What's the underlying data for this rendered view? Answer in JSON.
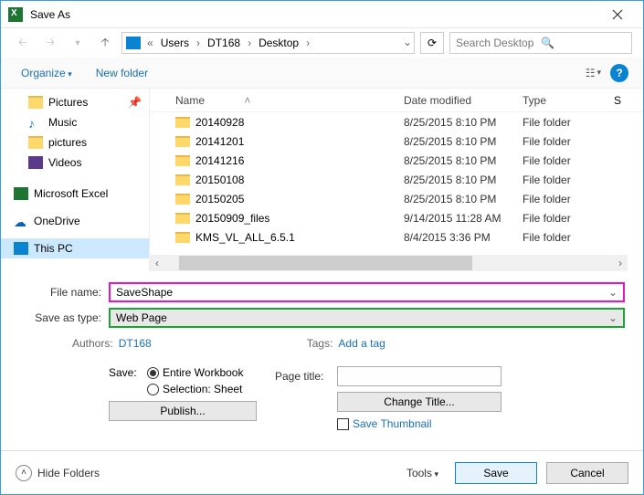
{
  "window": {
    "title": "Save As"
  },
  "breadcrumb": {
    "parts": [
      "Users",
      "DT168",
      "Desktop"
    ],
    "prefix": "«"
  },
  "search": {
    "placeholder": "Search Desktop"
  },
  "toolbar": {
    "organize": "Organize",
    "newfolder": "New folder"
  },
  "sidebar": {
    "items": [
      {
        "label": "Pictures",
        "icon": "folder",
        "pin": true
      },
      {
        "label": "Music",
        "icon": "music"
      },
      {
        "label": "pictures",
        "icon": "folder"
      },
      {
        "label": "Videos",
        "icon": "video"
      }
    ],
    "spacer": true,
    "items2": [
      {
        "label": "Microsoft Excel",
        "icon": "excel"
      },
      {
        "label": "OneDrive",
        "icon": "onedrive"
      },
      {
        "label": "This PC",
        "icon": "pc",
        "selected": true
      }
    ]
  },
  "columns": {
    "name": "Name",
    "date": "Date modified",
    "type": "Type",
    "size": "S"
  },
  "files": [
    {
      "name": "20140928",
      "date": "8/25/2015 8:10 PM",
      "type": "File folder"
    },
    {
      "name": "20141201",
      "date": "8/25/2015 8:10 PM",
      "type": "File folder"
    },
    {
      "name": "20141216",
      "date": "8/25/2015 8:10 PM",
      "type": "File folder"
    },
    {
      "name": "20150108",
      "date": "8/25/2015 8:10 PM",
      "type": "File folder"
    },
    {
      "name": "20150205",
      "date": "8/25/2015 8:10 PM",
      "type": "File folder"
    },
    {
      "name": "20150909_files",
      "date": "9/14/2015 11:28 AM",
      "type": "File folder"
    },
    {
      "name": "KMS_VL_ALL_6.5.1",
      "date": "8/4/2015 3:36 PM",
      "type": "File folder"
    }
  ],
  "form": {
    "filename_label": "File name:",
    "filename": "SaveShape",
    "type_label": "Save as type:",
    "type": "Web Page",
    "authors_label": "Authors:",
    "authors": "DT168",
    "tags_label": "Tags:",
    "tags": "Add a tag",
    "save_label": "Save:",
    "radio1": "Entire Workbook",
    "radio2": "Selection: Sheet",
    "publish": "Publish...",
    "pagetitle_label": "Page title:",
    "changetitle": "Change Title...",
    "savethumbnail": "Save Thumbnail"
  },
  "footer": {
    "hidefolders": "Hide Folders",
    "tools": "Tools",
    "save": "Save",
    "cancel": "Cancel"
  }
}
